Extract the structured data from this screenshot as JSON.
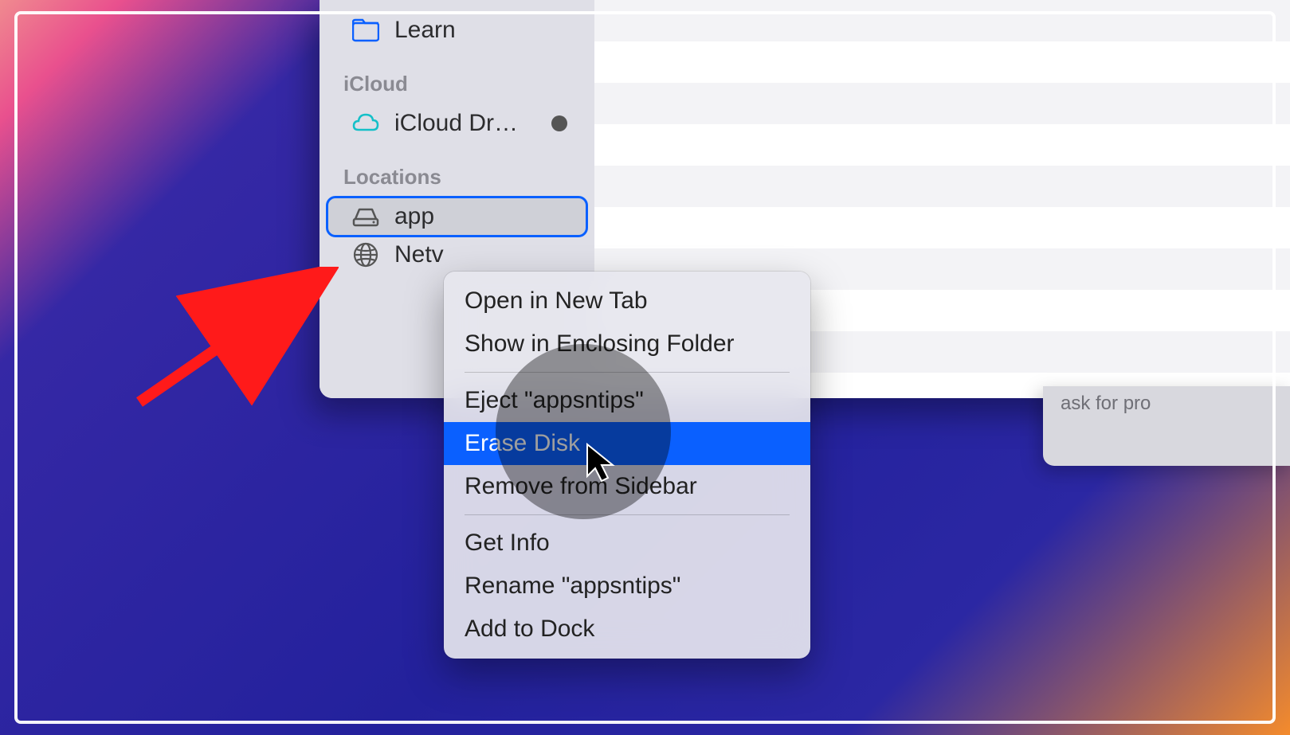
{
  "sidebar": {
    "favorites_item_learn": "Learn",
    "section_icloud": "iCloud",
    "icloud_drive_label": "iCloud Dr…",
    "section_locations": "Locations",
    "disk_label": "app",
    "network_label": "Netv"
  },
  "context_menu": {
    "open_new_tab": "Open in New Tab",
    "show_enclosing": "Show in Enclosing Folder",
    "eject": "Eject \"appsntips\"",
    "erase_disk": "Erase Disk",
    "remove_sidebar": "Remove from Sidebar",
    "get_info": "Get Info",
    "rename": "Rename \"appsntips\"",
    "add_to_dock": "Add to Dock"
  },
  "bottom_panel_text": "ask for pro"
}
